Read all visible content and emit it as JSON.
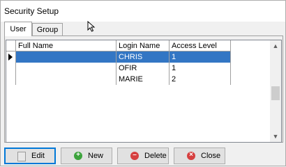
{
  "window": {
    "title": "Security Setup"
  },
  "tabs": [
    {
      "label": "User",
      "active": true
    },
    {
      "label": "Group",
      "active": false
    }
  ],
  "grid": {
    "columns": [
      "Full Name",
      "Login Name",
      "Access Level"
    ],
    "rows": [
      {
        "full_name": "",
        "login_name": "CHRIS",
        "access_level": "1",
        "selected": true
      },
      {
        "full_name": "",
        "login_name": "OFIR",
        "access_level": "1",
        "selected": false
      },
      {
        "full_name": "",
        "login_name": "MARIE",
        "access_level": "2",
        "selected": false
      }
    ]
  },
  "buttons": {
    "edit": "Edit",
    "new": "New",
    "delete": "Delete",
    "close": "Close"
  },
  "colors": {
    "selection": "#3376c4",
    "focus": "#0078d7"
  }
}
